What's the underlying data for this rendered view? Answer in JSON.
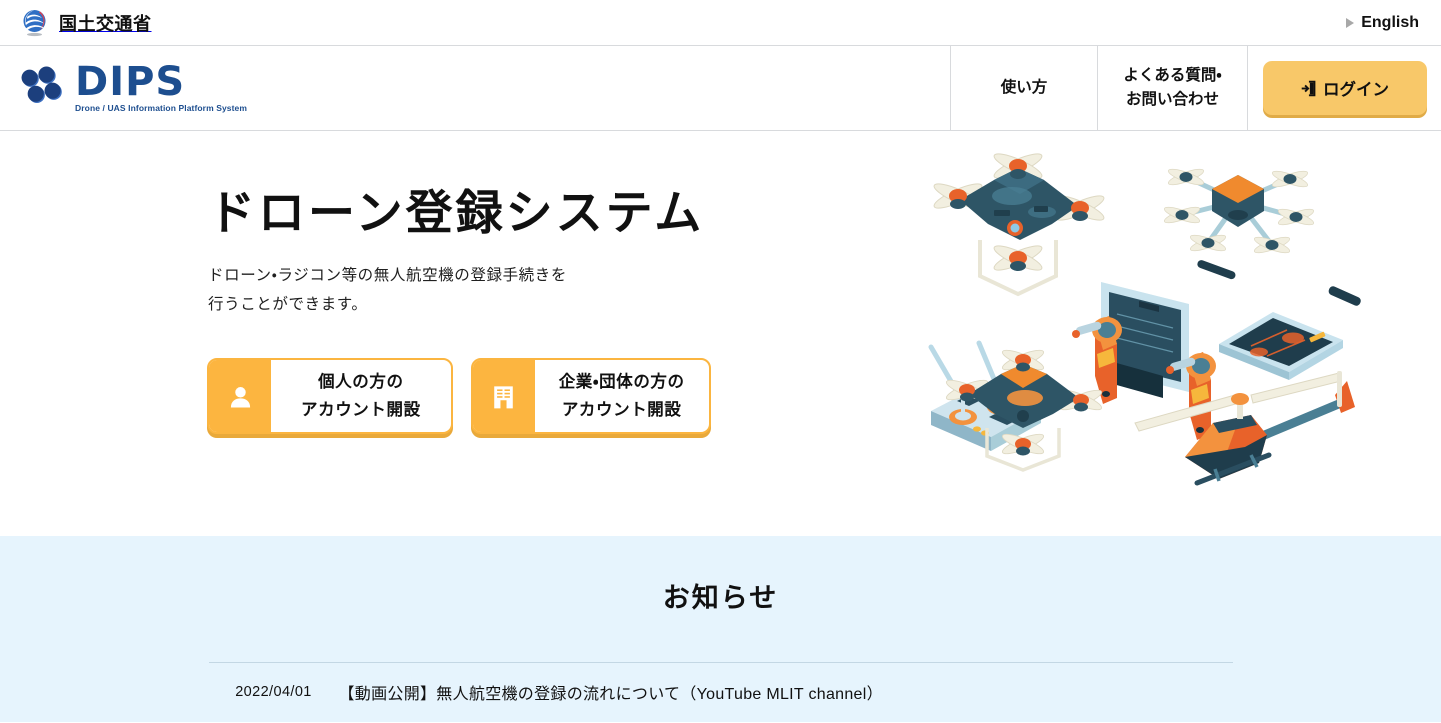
{
  "topbar": {
    "ministry_name": "国土交通省",
    "ministry_logo_icon": "mlit-swirl-icon",
    "language_label": "English",
    "language_marker_icon": "triangle-right-icon"
  },
  "header": {
    "logo_text": "DIPS",
    "logo_tagline": "Drone / UAS Information Platform System",
    "logo_mark_icon": "dips-four-dots-icon",
    "nav": [
      {
        "label": "使い方",
        "name": "nav-howto"
      },
      {
        "label": "よくある質問・\nお問い合わせ",
        "line1": "よくある質問・",
        "line2": "お問い合わせ",
        "name": "nav-faq"
      }
    ],
    "login": {
      "label": "ログイン",
      "icon": "sign-in-door-icon",
      "bg_color": "#f8c869"
    }
  },
  "hero": {
    "title": "ドローン登録システム",
    "subtitle_line1": "ドローン・ラジコン等の無人航空機の登録手続きを",
    "subtitle_line2": "行うことができます。",
    "cta": [
      {
        "name": "cta-personal-account",
        "icon": "person-icon",
        "line1": "個人の方の",
        "line2": "アカウント開設"
      },
      {
        "name": "cta-corporate-account",
        "icon": "building-icon",
        "line1": "企業・団体の方の",
        "line2": "アカウント開設"
      }
    ],
    "illustration_alt": "isometric-drones-illustration",
    "accent_color": "#fcb540"
  },
  "news": {
    "heading": "お知らせ",
    "items": [
      {
        "date": "2022/04/01",
        "text": "【動画公開】無人航空機の登録の流れについて（YouTube MLIT channel）"
      }
    ]
  },
  "colors": {
    "accent_orange": "#fcb540",
    "logo_blue": "#1d4e8f",
    "news_bg": "#e6f4fd",
    "border": "#d8dadd"
  }
}
